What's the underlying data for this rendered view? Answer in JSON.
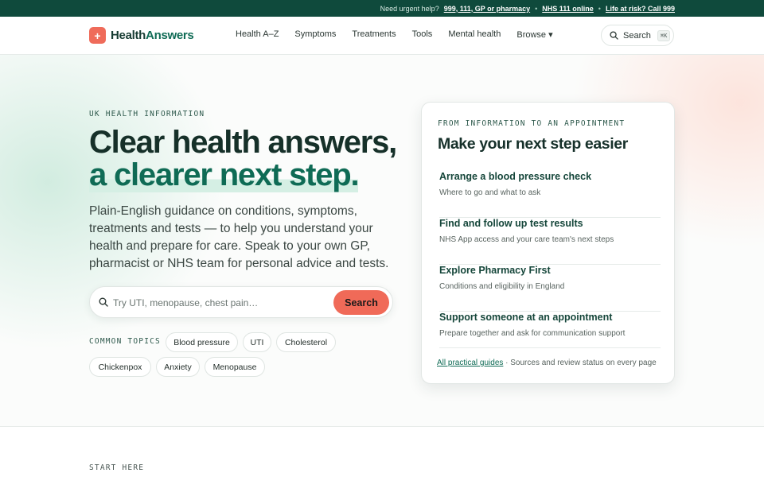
{
  "topbar": {
    "prompt": "Need urgent help?",
    "link_emergency": "999, 111, GP or pharmacy",
    "link_111": "NHS 111 online",
    "link_risk": "Life at risk? Call 999",
    "separator": "•"
  },
  "header": {
    "logo_plus": "+",
    "logo_part1": "Health",
    "logo_part2": "Answers",
    "nav": [
      "Health A–Z",
      "Symptoms",
      "Treatments",
      "Tools",
      "Mental health",
      "Browse ▾"
    ],
    "search_label": "Search",
    "search_shortcut": "⌘K"
  },
  "hero": {
    "eyebrow": "UK HEALTH INFORMATION",
    "headline_line1": "Clear health answers,",
    "headline_line2": "a clearer next step.",
    "lede": "Plain-English guidance on conditions, symptoms, treatments and tests — to help you understand your health and prepare for care. Speak to your own GP, pharmacist or NHS team for personal advice and tests.",
    "search": {
      "placeholder": "Try UTI, menopause, chest pain…",
      "button": "Search"
    },
    "common_topics_label": "COMMON TOPICS",
    "topics": [
      "Blood pressure",
      "UTI",
      "Cholesterol",
      "Chickenpox",
      "Anxiety",
      "Menopause"
    ]
  },
  "card": {
    "eyebrow": "FROM INFORMATION TO AN APPOINTMENT",
    "title": "Make your next step easier",
    "steps": [
      {
        "title": "Arrange a blood pressure check",
        "subtitle": "Where to go and what to ask"
      },
      {
        "title": "Find and follow up test results",
        "subtitle": "NHS App access and your care team's next steps"
      },
      {
        "title": "Explore Pharmacy First",
        "subtitle": "Conditions and eligibility in England"
      },
      {
        "title": "Support someone at an appointment",
        "subtitle": "Prepare together and ask for communication support"
      }
    ],
    "footer_link": "All practical guides",
    "footer_text": " · Sources and review status on every page"
  },
  "next_section": {
    "eyebrow": "START HERE"
  },
  "colors": {
    "brand_dark": "#0f4a3c",
    "brand_green": "#0f6b55",
    "accent_coral": "#f06a58"
  }
}
